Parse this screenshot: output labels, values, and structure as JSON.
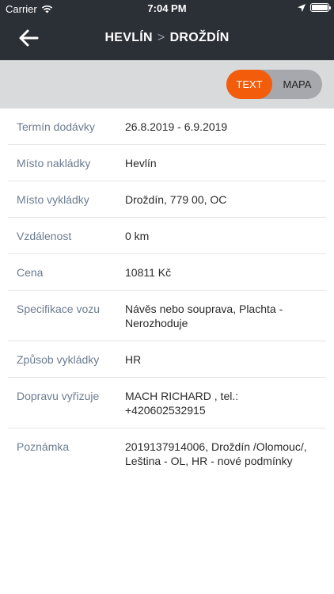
{
  "status_bar": {
    "carrier": "Carrier",
    "time": "7:04 PM"
  },
  "header": {
    "origin": "HEVLÍN",
    "separator": ">",
    "destination": "DROŽDÍN"
  },
  "view_toggle": {
    "text_label": "TEXT",
    "map_label": "MAPA",
    "selected": "TEXT"
  },
  "details": [
    {
      "label": "Termín dodávky",
      "value": "26.8.2019 - 6.9.2019"
    },
    {
      "label": "Místo nakládky",
      "value": "Hevlín"
    },
    {
      "label": "Místo vykládky",
      "value": "Droždín, 779 00, OC"
    },
    {
      "label": "Vzdálenost",
      "value": "0 km"
    },
    {
      "label": "Cena",
      "value": "10811 Kč"
    },
    {
      "label": "Specifikace vozu",
      "value": "Návěs nebo souprava, Plachta - Nerozhoduje"
    },
    {
      "label": "Způsob vykládky",
      "value": "HR"
    },
    {
      "label": "Dopravu vyřizuje",
      "value": "MACH RICHARD , tel.: +420602532915"
    },
    {
      "label": "Poznámka",
      "value": "2019137914006, Droždín /Olomouc/, Leština - OL, HR - nové podmínky"
    }
  ],
  "colors": {
    "header_bg": "#2b2f36",
    "accent": "#f25c0a",
    "label": "#6c7c90",
    "toggle_bar_bg": "#d9dadc"
  }
}
